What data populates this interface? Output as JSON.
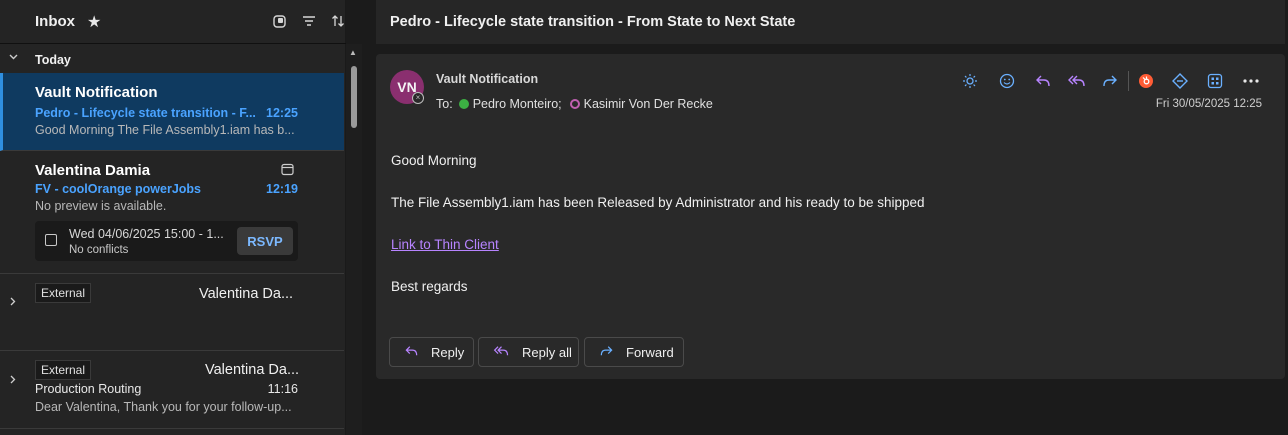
{
  "list": {
    "title": "Inbox",
    "group_today": "Today",
    "items": [
      {
        "sender": "Vault Notification",
        "subject": "Pedro - Lifecycle state transition - F...",
        "time": "12:25",
        "preview": "Good Morning The File Assembly1.iam has b..."
      },
      {
        "sender": "Valentina Damia",
        "subject": "FV - coolOrange powerJobs",
        "time": "12:19",
        "preview": "No preview is available.",
        "event": "Wed 04/06/2025 15:00 - 1...",
        "event_status": "No conflicts",
        "rsvp": "RSVP"
      },
      {
        "tag": "External",
        "sender": "Valentina Da..."
      },
      {
        "tag": "External",
        "sender": "Valentina Da...",
        "subject": "Production Routing",
        "time": "11:16",
        "preview": "Dear Valentina, Thank you for your follow-up..."
      }
    ]
  },
  "reading": {
    "subject": "Pedro - Lifecycle state transition - From State to Next State",
    "avatar_initials": "VN",
    "from": "Vault Notification",
    "to_label": "To:",
    "recipient1": "Pedro Monteiro;",
    "recipient2": "Kasimir Von Der Recke",
    "date": "Fri 30/05/2025 12:25",
    "body": {
      "greeting": "Good Morning",
      "line": "The File Assembly1.iam has been Released by Administrator and his ready to be shipped",
      "link": "Link to Thin Client",
      "closing": "Best regards"
    },
    "buttons": {
      "reply": "Reply",
      "reply_all": "Reply all",
      "forward": "Forward"
    }
  },
  "colors": {
    "accent": "#4aa3ff",
    "selected_bg": "#0f3a60",
    "avatar": "#8a2f6f",
    "link": "#b784ff"
  }
}
